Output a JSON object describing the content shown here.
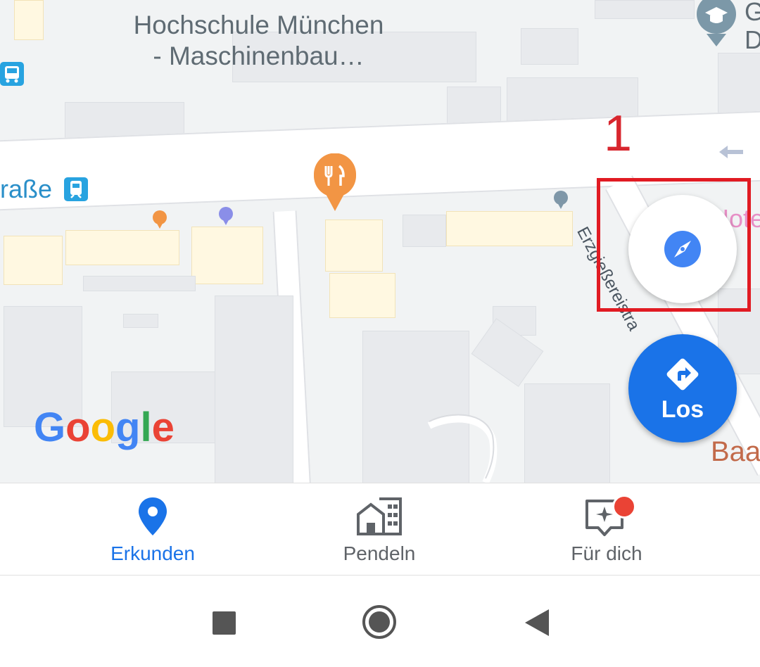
{
  "map": {
    "place_label_line1": "Hochschule München",
    "place_label_line2": "- Maschinenbau…",
    "street_label_left": "raße",
    "street_label_diagonal": "Erzgießereistra",
    "edge_label_top_right_1": "G",
    "edge_label_top_right_2": "D",
    "edge_label_hotel": "Hote",
    "edge_label_bottom_right": "Baa",
    "google_logo": {
      "letters": [
        "G",
        "o",
        "o",
        "g",
        "l",
        "e"
      ],
      "colors": [
        "#4285F4",
        "#EA4335",
        "#FBBC05",
        "#4285F4",
        "#34A853",
        "#EA4335"
      ]
    }
  },
  "annotation": {
    "number": "1",
    "box_color": "#e11b23"
  },
  "buttons": {
    "compass_icon": "compass-icon",
    "los_label": "Los",
    "los_icon": "directions-icon"
  },
  "bottom_nav": {
    "items": [
      {
        "label": "Erkunden",
        "icon": "location-pin-icon",
        "active": true
      },
      {
        "label": "Pendeln",
        "icon": "commute-buildings-icon",
        "active": false
      },
      {
        "label": "Für dich",
        "icon": "for-you-sparkle-icon",
        "active": false,
        "has_notification_dot": true
      }
    ],
    "active_color": "#1a73e8",
    "inactive_color": "#5f6368",
    "notification_color": "#ea4335"
  },
  "system_nav": {
    "recents": "recents-icon",
    "home": "home-icon",
    "back": "back-icon"
  }
}
